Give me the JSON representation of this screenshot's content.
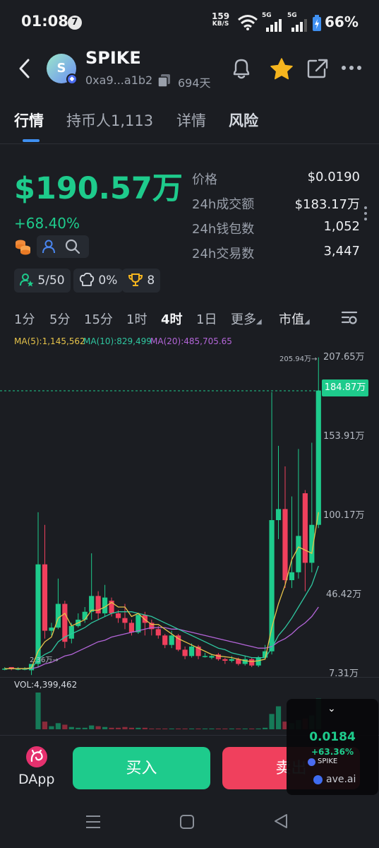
{
  "status_bar": {
    "time": "01:08",
    "notif_count": "7",
    "speed_value": "159",
    "speed_unit": "KB/S",
    "network_1": "5G",
    "network_2": "5G",
    "battery": "66%"
  },
  "header": {
    "token_name": "SPIKE",
    "avatar_letter": "S",
    "address": "0xa9...a1b2",
    "age": "694天"
  },
  "tabs": [
    {
      "label": "行情",
      "active": true
    },
    {
      "label": "持币人1,113",
      "active": false
    },
    {
      "label": "详情",
      "active": false
    },
    {
      "label": "风险",
      "active": false
    }
  ],
  "summary": {
    "market_cap": "$190.57万",
    "change": "+68.40%",
    "insider": "5/50",
    "dev": "0%",
    "trophy": "8"
  },
  "stats": [
    {
      "label": "价格",
      "value": "$0.0190"
    },
    {
      "label": "24h成交额",
      "value": "$183.17万"
    },
    {
      "label": "24h钱包数",
      "value": "1,052"
    },
    {
      "label": "24h交易数",
      "value": "3,447"
    }
  ],
  "timeframes": [
    "1分",
    "5分",
    "15分",
    "1时",
    "4时",
    "1日",
    "更多",
    "市值"
  ],
  "active_timeframe": "4时",
  "ma": {
    "ma5": "MA(5):1,145,562",
    "ma10": "MA(10):829,499",
    "ma20": "MA(20):485,705.65"
  },
  "colors": {
    "up": "#1ecb8c",
    "down": "#f0405d",
    "ma5": "#e6c34a",
    "ma10": "#2fc7a0",
    "ma20": "#b365d8"
  },
  "chart_data": {
    "type": "candlestick",
    "y_axis_labels": [
      "207.65万",
      "153.91万",
      "100.17万",
      "46.42万",
      "7.31万"
    ],
    "y_axis_values": [
      207.65,
      153.91,
      100.17,
      46.42,
      7.31
    ],
    "ylim": [
      7.31,
      207.65
    ],
    "high_label": "205.94万",
    "low_label": "2.36万",
    "current_label": "184.87万",
    "current_value": 184.87,
    "candles": [
      {
        "o": 9,
        "c": 9,
        "h": 10,
        "l": 8
      },
      {
        "o": 10,
        "c": 9,
        "h": 10,
        "l": 8
      },
      {
        "o": 9,
        "c": 9,
        "h": 10,
        "l": 8
      },
      {
        "o": 9,
        "c": 9,
        "h": 10,
        "l": 8
      },
      {
        "o": 8,
        "c": 12,
        "h": 12,
        "l": 5
      },
      {
        "o": 12,
        "c": 75,
        "h": 108,
        "l": 10
      },
      {
        "o": 75,
        "c": 33,
        "h": 100,
        "l": 28
      },
      {
        "o": 33,
        "c": 35,
        "h": 38,
        "l": 30
      },
      {
        "o": 35,
        "c": 50,
        "h": 66,
        "l": 34
      },
      {
        "o": 50,
        "c": 26,
        "h": 52,
        "l": 22
      },
      {
        "o": 28,
        "c": 36,
        "h": 38,
        "l": 25
      },
      {
        "o": 36,
        "c": 40,
        "h": 44,
        "l": 35
      },
      {
        "o": 40,
        "c": 45,
        "h": 48,
        "l": 38
      },
      {
        "o": 45,
        "c": 55,
        "h": 82,
        "l": 40
      },
      {
        "o": 55,
        "c": 44,
        "h": 58,
        "l": 40
      },
      {
        "o": 44,
        "c": 54,
        "h": 62,
        "l": 42
      },
      {
        "o": 52,
        "c": 44,
        "h": 54,
        "l": 42
      },
      {
        "o": 44,
        "c": 41,
        "h": 46,
        "l": 38
      },
      {
        "o": 41,
        "c": 38,
        "h": 50,
        "l": 34
      },
      {
        "o": 38,
        "c": 32,
        "h": 40,
        "l": 30
      },
      {
        "o": 32,
        "c": 43,
        "h": 44,
        "l": 31
      },
      {
        "o": 43,
        "c": 38,
        "h": 45,
        "l": 30
      },
      {
        "o": 38,
        "c": 34,
        "h": 40,
        "l": 30
      },
      {
        "o": 34,
        "c": 30,
        "h": 36,
        "l": 28
      },
      {
        "o": 30,
        "c": 24,
        "h": 31,
        "l": 22
      },
      {
        "o": 24,
        "c": 30,
        "h": 33,
        "l": 22
      },
      {
        "o": 30,
        "c": 21,
        "h": 31,
        "l": 20
      },
      {
        "o": 21,
        "c": 17,
        "h": 23,
        "l": 15
      },
      {
        "o": 17,
        "c": 23,
        "h": 25,
        "l": 16
      },
      {
        "o": 23,
        "c": 17,
        "h": 24,
        "l": 15
      },
      {
        "o": 17,
        "c": 17,
        "h": 19,
        "l": 16
      },
      {
        "o": 16,
        "c": 17,
        "h": 18,
        "l": 15
      },
      {
        "o": 18,
        "c": 15,
        "h": 19,
        "l": 14
      },
      {
        "o": 15,
        "c": 14,
        "h": 16,
        "l": 12
      },
      {
        "o": 14,
        "c": 15,
        "h": 17,
        "l": 13
      },
      {
        "o": 15,
        "c": 12,
        "h": 16,
        "l": 11
      },
      {
        "o": 12,
        "c": 15,
        "h": 17,
        "l": 11
      },
      {
        "o": 15,
        "c": 11,
        "h": 16,
        "l": 10
      },
      {
        "o": 11,
        "c": 16,
        "h": 17,
        "l": 10
      },
      {
        "o": 16,
        "c": 20,
        "h": 24,
        "l": 15
      },
      {
        "o": 20,
        "c": 103,
        "h": 184,
        "l": 18
      },
      {
        "o": 103,
        "c": 110,
        "h": 150,
        "l": 91
      },
      {
        "o": 110,
        "c": 65,
        "h": 137,
        "l": 60
      },
      {
        "o": 65,
        "c": 70,
        "h": 118,
        "l": 60
      },
      {
        "o": 70,
        "c": 93,
        "h": 148,
        "l": 66
      },
      {
        "o": 120,
        "c": 76,
        "h": 122,
        "l": 58
      },
      {
        "o": 76,
        "c": 100,
        "h": 152,
        "l": 70
      },
      {
        "o": 100,
        "c": 185,
        "h": 206,
        "l": 98
      }
    ],
    "ma5": [
      9,
      9,
      9,
      9,
      9.5,
      20,
      26,
      29,
      41,
      44,
      36,
      38,
      40,
      46,
      46,
      48,
      51,
      48,
      48,
      42,
      44,
      40,
      37,
      37,
      34,
      31,
      28,
      26,
      24,
      22,
      20,
      18,
      17,
      16.5,
      16,
      15,
      14,
      13.5,
      14,
      15,
      35,
      50,
      62,
      78,
      86,
      84,
      82,
      108
    ],
    "ma10": [
      9,
      9,
      9,
      9,
      9,
      15,
      18,
      20,
      26,
      29,
      31,
      33,
      35,
      38,
      40,
      42,
      44,
      45,
      45,
      45,
      44,
      43,
      42,
      40,
      38,
      36,
      34,
      32,
      30,
      28,
      26,
      24,
      22,
      21,
      19,
      18,
      17,
      16,
      16,
      16,
      22,
      30,
      35,
      41,
      48,
      55,
      62,
      74
    ],
    "ma20": [
      9,
      9,
      9,
      9,
      9,
      10,
      12,
      13,
      15,
      17,
      18,
      20,
      22,
      24,
      26,
      27,
      29,
      30,
      31,
      32,
      33,
      34,
      35,
      35,
      35,
      34,
      34,
      33,
      32,
      31,
      30,
      29,
      28,
      27,
      26,
      25,
      24,
      23,
      22,
      22,
      23,
      26,
      28,
      31,
      35,
      38,
      42,
      48
    ],
    "volume_label": "VOL:4,399,462",
    "volumes": [
      0,
      0,
      0,
      0,
      0,
      48,
      10,
      4,
      8,
      6,
      3,
      2,
      2,
      5,
      4,
      3,
      2,
      2,
      3,
      2,
      2,
      2,
      1,
      1,
      1,
      1,
      1,
      1,
      1,
      1,
      1,
      1,
      1,
      1,
      1,
      1,
      1,
      1,
      1,
      2,
      20,
      30,
      10,
      8,
      12,
      14,
      18,
      40
    ]
  },
  "actions": {
    "dapp": "DApp",
    "buy": "买入",
    "sell": "卖出"
  },
  "widget": {
    "price": "0.0184",
    "change": "+63.36%",
    "symbol": "SPIKE",
    "site": "ave.ai"
  }
}
